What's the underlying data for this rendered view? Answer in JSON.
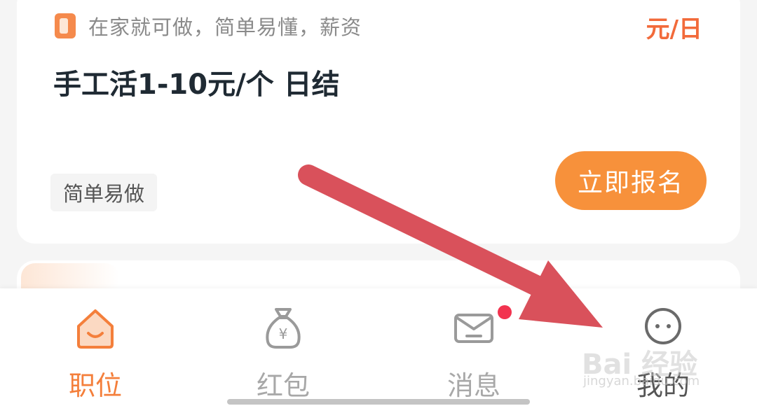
{
  "job_card": {
    "source_text": "在家就可做，简单易懂，薪资",
    "pay_text": "元/日",
    "title": "手工活1-10元/个 日结",
    "tag": "简单易做",
    "apply_label": "立即报名"
  },
  "tab_bar": {
    "items": [
      {
        "label": "职位",
        "icon": "home-icon",
        "active": true
      },
      {
        "label": "红包",
        "icon": "money-bag-icon",
        "active": false
      },
      {
        "label": "消息",
        "icon": "envelope-icon",
        "active": false,
        "has_badge": true
      },
      {
        "label": "我的",
        "icon": "profile-face-icon",
        "active": false
      }
    ]
  },
  "watermark": {
    "text": "Bai 经验",
    "sub": "jingyan.baidu.com"
  },
  "colors": {
    "accent": "#f7913b",
    "arrow": "#d9515b",
    "badge": "#f2334f"
  }
}
